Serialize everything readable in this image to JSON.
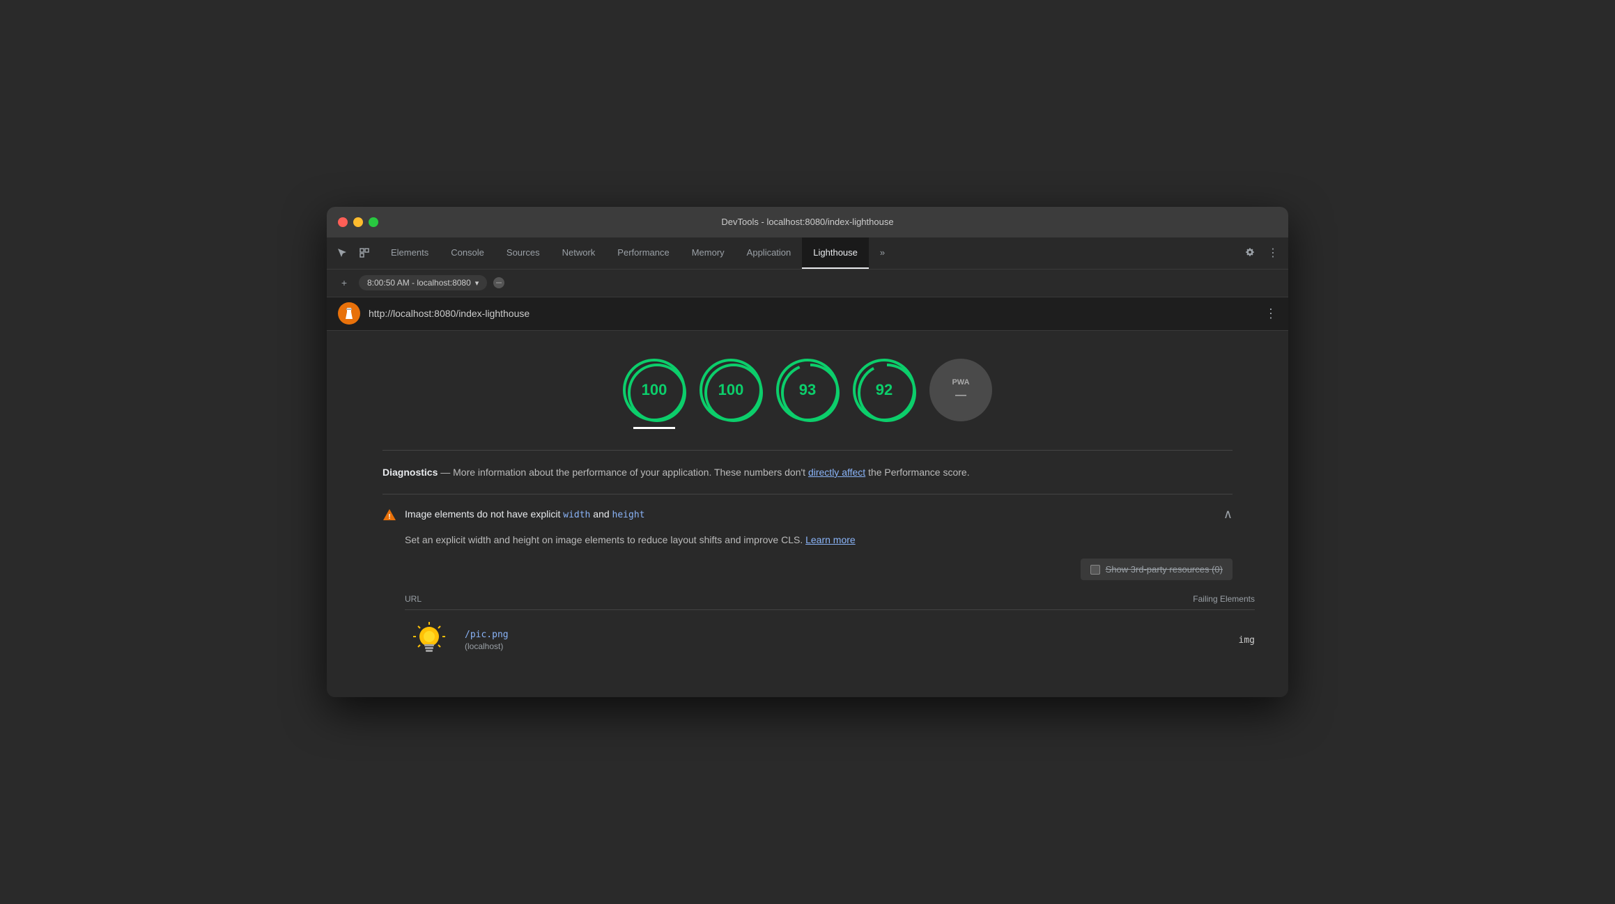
{
  "window": {
    "title": "DevTools - localhost:8080/index-lighthouse"
  },
  "tabs": {
    "items": [
      {
        "label": "Elements",
        "active": false
      },
      {
        "label": "Console",
        "active": false
      },
      {
        "label": "Sources",
        "active": false
      },
      {
        "label": "Network",
        "active": false
      },
      {
        "label": "Performance",
        "active": false
      },
      {
        "label": "Memory",
        "active": false
      },
      {
        "label": "Application",
        "active": false
      },
      {
        "label": "Lighthouse",
        "active": true
      }
    ],
    "more_label": "»"
  },
  "toolbar": {
    "url_display": "8:00:50 AM - localhost:8080",
    "dropdown_icon": "▾"
  },
  "urlbar": {
    "url": "http://localhost:8080/index-lighthouse",
    "menu_icon": "⋮"
  },
  "scores": [
    {
      "value": "100",
      "type": "green"
    },
    {
      "value": "100",
      "type": "green"
    },
    {
      "value": "93",
      "type": "green"
    },
    {
      "value": "92",
      "type": "green"
    },
    {
      "value": "PWA",
      "type": "pwa"
    }
  ],
  "diagnostics": {
    "label": "Diagnostics",
    "text": " — More information about the performance of your application. These numbers don't ",
    "link_text": "directly affect",
    "text2": " the Performance score."
  },
  "audit": {
    "title_prefix": "Image elements do not have explicit ",
    "title_code1": "width",
    "title_and": " and ",
    "title_code2": "height",
    "description": "Set an explicit width and height on image elements to reduce layout shifts and improve CLS.",
    "learn_more": "Learn more",
    "third_party_label": "Show 3rd-party resources (0)",
    "table": {
      "col_url": "URL",
      "col_failing": "Failing Elements",
      "rows": [
        {
          "url": "/pic.png",
          "host": "(localhost)",
          "failing": "img"
        }
      ]
    }
  },
  "icons": {
    "cursor": "⊹",
    "layers": "⧉",
    "settings": "⚙",
    "kebab": "⋮",
    "stop": "⊘",
    "warning": "▲",
    "chevron_up": "∧"
  },
  "colors": {
    "green": "#0cce6b",
    "blue_link": "#8ab4f8",
    "warning_orange": "#e8710a",
    "bg_dark": "#292929",
    "tab_active_bg": "#1a1a1a"
  }
}
